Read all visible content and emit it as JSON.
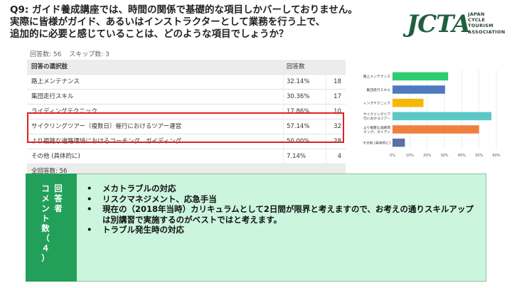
{
  "header": {
    "title_lines": [
      "Q9: ガイド養成講座では、時間の関係で基礎的な項目しかバーしておりません。",
      "実際に皆様がガイド、あるいはインストラクターとして業務を行う上で、",
      "追加的に必要と感じていることは、どのような項目でしょうか？"
    ]
  },
  "logo": {
    "mark": "JCTA",
    "lines": [
      "JAPAN",
      "CYCLE",
      "TOURISM",
      "ASSOCIATION"
    ]
  },
  "stats": {
    "responses": "回答数: 56",
    "skips": "スキップ数: 3"
  },
  "table": {
    "headers": [
      "回答の選択肢",
      "回答数",
      ""
    ],
    "rows": [
      {
        "label": "路上メンテナンス",
        "percent": "32.14%",
        "count": "18"
      },
      {
        "label": "集団走行スキル",
        "percent": "30.36%",
        "count": "17"
      },
      {
        "label": "ライディングテクニック",
        "percent": "17.86%",
        "count": "10"
      },
      {
        "label": "サイクリングツアー（複数日）催行におけるツアー運営",
        "percent": "57.14%",
        "count": "32"
      },
      {
        "label": "より複雑な道路環境におけるコーチング、ガイディング",
        "percent": "50.00%",
        "count": "28"
      },
      {
        "label": "その他 (具体的に)",
        "percent": "7.14%",
        "count": "4"
      }
    ],
    "total": "全回答数: 56"
  },
  "chart_data": {
    "type": "bar",
    "orientation": "horizontal",
    "categories": [
      [
        "路上メンテナンス"
      ],
      [
        "集団走行スキル"
      ],
      [
        "ィングテクニック"
      ],
      [
        "サイクリングツア",
        "行におけるツアー"
      ],
      [
        "より複雑な道路環",
        "チング、ガイディ"
      ],
      [
        "その他 (具体的に)"
      ]
    ],
    "values": [
      32.14,
      30.36,
      17.86,
      57.14,
      50.0,
      7.14
    ],
    "colors": [
      "#2ecc71",
      "#4f7ac0",
      "#f5b800",
      "#5bc8c8",
      "#f07f3f",
      "#5a6fa8"
    ],
    "xlim": [
      0,
      60
    ],
    "xticks": [
      "0%",
      "10%",
      "20%",
      "30%",
      "40%",
      "50%",
      "60%"
    ],
    "grid": true
  },
  "comments": {
    "label_right": "回答者",
    "label_left": "コメント数（４）",
    "items": [
      "メカトラブルの対応",
      "リスクマネジメント、応急手当",
      "現在の（2018年当時）カリキュラムとして2日間が限界と考えますので、お考えの通りスキルアップは別講習で実施するのがベストではと考えます。",
      "トラブル発生時の対応"
    ]
  }
}
